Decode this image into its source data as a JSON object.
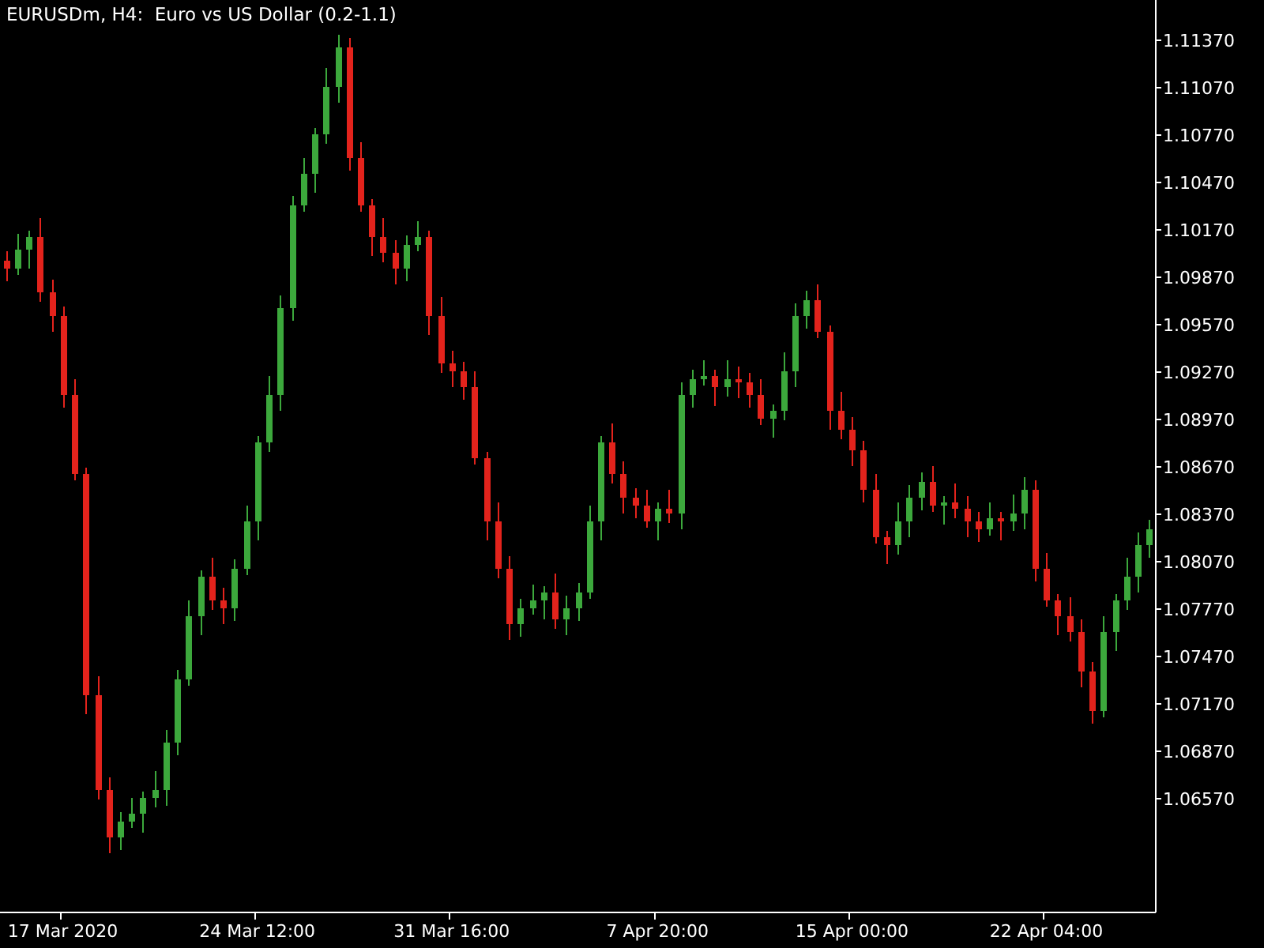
{
  "chart": {
    "title": "EURUSDm, H4:  Euro vs US Dollar (0.2-1.1)",
    "chart_data": {
      "type": "candlestick",
      "ylim": [
        1.0585,
        1.1162
      ],
      "yticks": [
        {
          "value": 1.1137,
          "label": "1.11370"
        },
        {
          "value": 1.1107,
          "label": "1.11070"
        },
        {
          "value": 1.1077,
          "label": "1.10770"
        },
        {
          "value": 1.1047,
          "label": "1.10470"
        },
        {
          "value": 1.1017,
          "label": "1.10170"
        },
        {
          "value": 1.0987,
          "label": "1.09870"
        },
        {
          "value": 1.0957,
          "label": "1.09570"
        },
        {
          "value": 1.0927,
          "label": "1.09270"
        },
        {
          "value": 1.0897,
          "label": "1.08970"
        },
        {
          "value": 1.0867,
          "label": "1.08670"
        },
        {
          "value": 1.0837,
          "label": "1.08370"
        },
        {
          "value": 1.0807,
          "label": "1.08070"
        },
        {
          "value": 1.0777,
          "label": "1.07770"
        },
        {
          "value": 1.0747,
          "label": "1.07470"
        },
        {
          "value": 1.0717,
          "label": "1.07170"
        },
        {
          "value": 1.0687,
          "label": "1.06870"
        },
        {
          "value": 1.0657,
          "label": "1.06570"
        }
      ],
      "categories": [
        null,
        null,
        null,
        null,
        null,
        "17 Mar 2020",
        null,
        null,
        null,
        null,
        null,
        null,
        null,
        null,
        null,
        null,
        null,
        null,
        null,
        null,
        null,
        null,
        "24 Mar 12:00",
        null,
        null,
        null,
        null,
        null,
        null,
        null,
        null,
        null,
        null,
        null,
        null,
        null,
        null,
        null,
        null,
        "31 Mar 16:00",
        null,
        null,
        null,
        null,
        null,
        null,
        null,
        null,
        null,
        null,
        null,
        null,
        null,
        null,
        null,
        null,
        null,
        "7 Apr 20:00",
        null,
        null,
        null,
        null,
        null,
        null,
        null,
        null,
        null,
        null,
        null,
        null,
        null,
        null,
        null,
        null,
        "15 Apr 00:00",
        null,
        null,
        null,
        null,
        null,
        null,
        null,
        null,
        null,
        null,
        null,
        null,
        null,
        null,
        null,
        null,
        "22 Apr 04:00",
        null,
        null,
        null,
        null,
        null,
        null,
        null,
        null,
        null
      ],
      "ohlc": [
        [
          1.0997,
          1.1003,
          1.0984,
          1.0992
        ],
        [
          1.0992,
          1.1014,
          1.0988,
          1.1004
        ],
        [
          1.1004,
          1.1016,
          1.0992,
          1.1012
        ],
        [
          1.1012,
          1.1024,
          1.0971,
          1.0977
        ],
        [
          1.0977,
          1.0985,
          1.0952,
          1.0962
        ],
        [
          1.0962,
          1.0968,
          1.0904,
          1.0912
        ],
        [
          1.0912,
          1.0922,
          1.0858,
          1.0862
        ],
        [
          1.0862,
          1.0866,
          1.071,
          1.0722
        ],
        [
          1.0722,
          1.0734,
          1.0656,
          1.0662
        ],
        [
          1.0662,
          1.067,
          1.0622,
          1.0632
        ],
        [
          1.0632,
          1.0648,
          1.0624,
          1.0642
        ],
        [
          1.0642,
          1.0657,
          1.0638,
          1.0647
        ],
        [
          1.0647,
          1.0661,
          1.0635,
          1.0657
        ],
        [
          1.0657,
          1.0674,
          1.0651,
          1.0662
        ],
        [
          1.0662,
          1.07,
          1.0652,
          1.0692
        ],
        [
          1.0692,
          1.0738,
          1.0684,
          1.0732
        ],
        [
          1.0732,
          1.0782,
          1.0728,
          1.0772
        ],
        [
          1.0772,
          1.0801,
          1.076,
          1.0797
        ],
        [
          1.0797,
          1.0809,
          1.0776,
          1.0782
        ],
        [
          1.0782,
          1.079,
          1.0767,
          1.0777
        ],
        [
          1.0777,
          1.0808,
          1.0769,
          1.0802
        ],
        [
          1.0802,
          1.0842,
          1.0798,
          1.0832
        ],
        [
          1.0832,
          1.0886,
          1.082,
          1.0882
        ],
        [
          1.0882,
          1.0924,
          1.0876,
          1.0912
        ],
        [
          1.0912,
          1.0975,
          1.0902,
          1.0967
        ],
        [
          1.0967,
          1.1038,
          1.0959,
          1.1032
        ],
        [
          1.1032,
          1.1062,
          1.1028,
          1.1052
        ],
        [
          1.1052,
          1.1081,
          1.104,
          1.1077
        ],
        [
          1.1077,
          1.1119,
          1.1071,
          1.1107
        ],
        [
          1.1107,
          1.114,
          1.1097,
          1.1132
        ],
        [
          1.1132,
          1.1138,
          1.1054,
          1.1062
        ],
        [
          1.1062,
          1.1072,
          1.1028,
          1.1032
        ],
        [
          1.1032,
          1.1036,
          1.1,
          1.1012
        ],
        [
          1.1012,
          1.1024,
          1.0996,
          1.1002
        ],
        [
          1.1002,
          1.101,
          1.0982,
          1.0992
        ],
        [
          1.0992,
          1.1013,
          1.0984,
          1.1007
        ],
        [
          1.1007,
          1.1022,
          1.1003,
          1.1012
        ],
        [
          1.1012,
          1.1016,
          1.095,
          1.0962
        ],
        [
          1.0962,
          1.0974,
          1.0926,
          1.0932
        ],
        [
          1.0932,
          1.094,
          1.0917,
          1.0927
        ],
        [
          1.0927,
          1.0933,
          1.0909,
          1.0917
        ],
        [
          1.0917,
          1.0927,
          1.0868,
          1.0872
        ],
        [
          1.0872,
          1.0876,
          1.082,
          1.0832
        ],
        [
          1.0832,
          1.0844,
          1.0796,
          1.0802
        ],
        [
          1.0802,
          1.081,
          1.0757,
          1.0767
        ],
        [
          1.0767,
          1.0783,
          1.0759,
          1.0777
        ],
        [
          1.0777,
          1.0792,
          1.0773,
          1.0782
        ],
        [
          1.0782,
          1.0791,
          1.077,
          1.0787
        ],
        [
          1.0787,
          1.0799,
          1.0764,
          1.077
        ],
        [
          1.077,
          1.0785,
          1.076,
          1.0777
        ],
        [
          1.0777,
          1.0793,
          1.0769,
          1.0787
        ],
        [
          1.0787,
          1.0842,
          1.0783,
          1.0832
        ],
        [
          1.0832,
          1.0886,
          1.082,
          1.0882
        ],
        [
          1.0882,
          1.0894,
          1.0856,
          1.0862
        ],
        [
          1.0862,
          1.087,
          1.0837,
          1.0847
        ],
        [
          1.0847,
          1.0853,
          1.0834,
          1.0842
        ],
        [
          1.0842,
          1.0852,
          1.0828,
          1.0832
        ],
        [
          1.0832,
          1.0844,
          1.082,
          1.084
        ],
        [
          1.084,
          1.0852,
          1.0831,
          1.0837
        ],
        [
          1.0837,
          1.092,
          1.0827,
          1.0912
        ],
        [
          1.0912,
          1.0928,
          1.0904,
          1.0922
        ],
        [
          1.0922,
          1.0934,
          1.0918,
          1.0924
        ],
        [
          1.0924,
          1.0928,
          1.0905,
          1.0917
        ],
        [
          1.0917,
          1.0934,
          1.0911,
          1.0922
        ],
        [
          1.0922,
          1.093,
          1.091,
          1.092
        ],
        [
          1.092,
          1.0926,
          1.0904,
          1.0912
        ],
        [
          1.0912,
          1.0922,
          1.0893,
          1.0897
        ],
        [
          1.0897,
          1.0906,
          1.0885,
          1.0902
        ],
        [
          1.0902,
          1.0939,
          1.0896,
          1.0927
        ],
        [
          1.0927,
          1.097,
          1.0917,
          1.0962
        ],
        [
          1.0962,
          1.0978,
          1.0954,
          1.0972
        ],
        [
          1.0972,
          1.0982,
          1.0948,
          1.0952
        ],
        [
          1.0952,
          1.0956,
          1.089,
          1.0902
        ],
        [
          1.0902,
          1.0914,
          1.0884,
          1.089
        ],
        [
          1.089,
          1.0898,
          1.0867,
          1.0877
        ],
        [
          1.0877,
          1.0883,
          1.0844,
          1.0852
        ],
        [
          1.0852,
          1.0862,
          1.0818,
          1.0822
        ],
        [
          1.0822,
          1.0826,
          1.0805,
          1.0817
        ],
        [
          1.0817,
          1.0844,
          1.0811,
          1.0832
        ],
        [
          1.0832,
          1.0855,
          1.0822,
          1.0847
        ],
        [
          1.0847,
          1.0863,
          1.0839,
          1.0857
        ],
        [
          1.0857,
          1.0867,
          1.0838,
          1.0842
        ],
        [
          1.0842,
          1.0848,
          1.083,
          1.0844
        ],
        [
          1.0844,
          1.0856,
          1.0834,
          1.084
        ],
        [
          1.084,
          1.0848,
          1.0822,
          1.0832
        ],
        [
          1.0832,
          1.0838,
          1.0819,
          1.0827
        ],
        [
          1.0827,
          1.0844,
          1.0823,
          1.0834
        ],
        [
          1.0834,
          1.0838,
          1.082,
          1.0832
        ],
        [
          1.0832,
          1.0849,
          1.0826,
          1.0837
        ],
        [
          1.0837,
          1.086,
          1.0827,
          1.0852
        ],
        [
          1.0852,
          1.0858,
          1.0794,
          1.0802
        ],
        [
          1.0802,
          1.0812,
          1.0778,
          1.0782
        ],
        [
          1.0782,
          1.0786,
          1.076,
          1.0772
        ],
        [
          1.0772,
          1.0784,
          1.0756,
          1.0762
        ],
        [
          1.0762,
          1.077,
          1.0727,
          1.0737
        ],
        [
          1.0737,
          1.0743,
          1.0704,
          1.0712
        ],
        [
          1.0712,
          1.0772,
          1.0708,
          1.0762
        ],
        [
          1.0762,
          1.0786,
          1.075,
          1.0782
        ],
        [
          1.0782,
          1.0809,
          1.0776,
          1.0797
        ],
        [
          1.0797,
          1.0825,
          1.0787,
          1.0817
        ],
        [
          1.0817,
          1.0833,
          1.0809,
          1.0827
        ]
      ]
    }
  }
}
